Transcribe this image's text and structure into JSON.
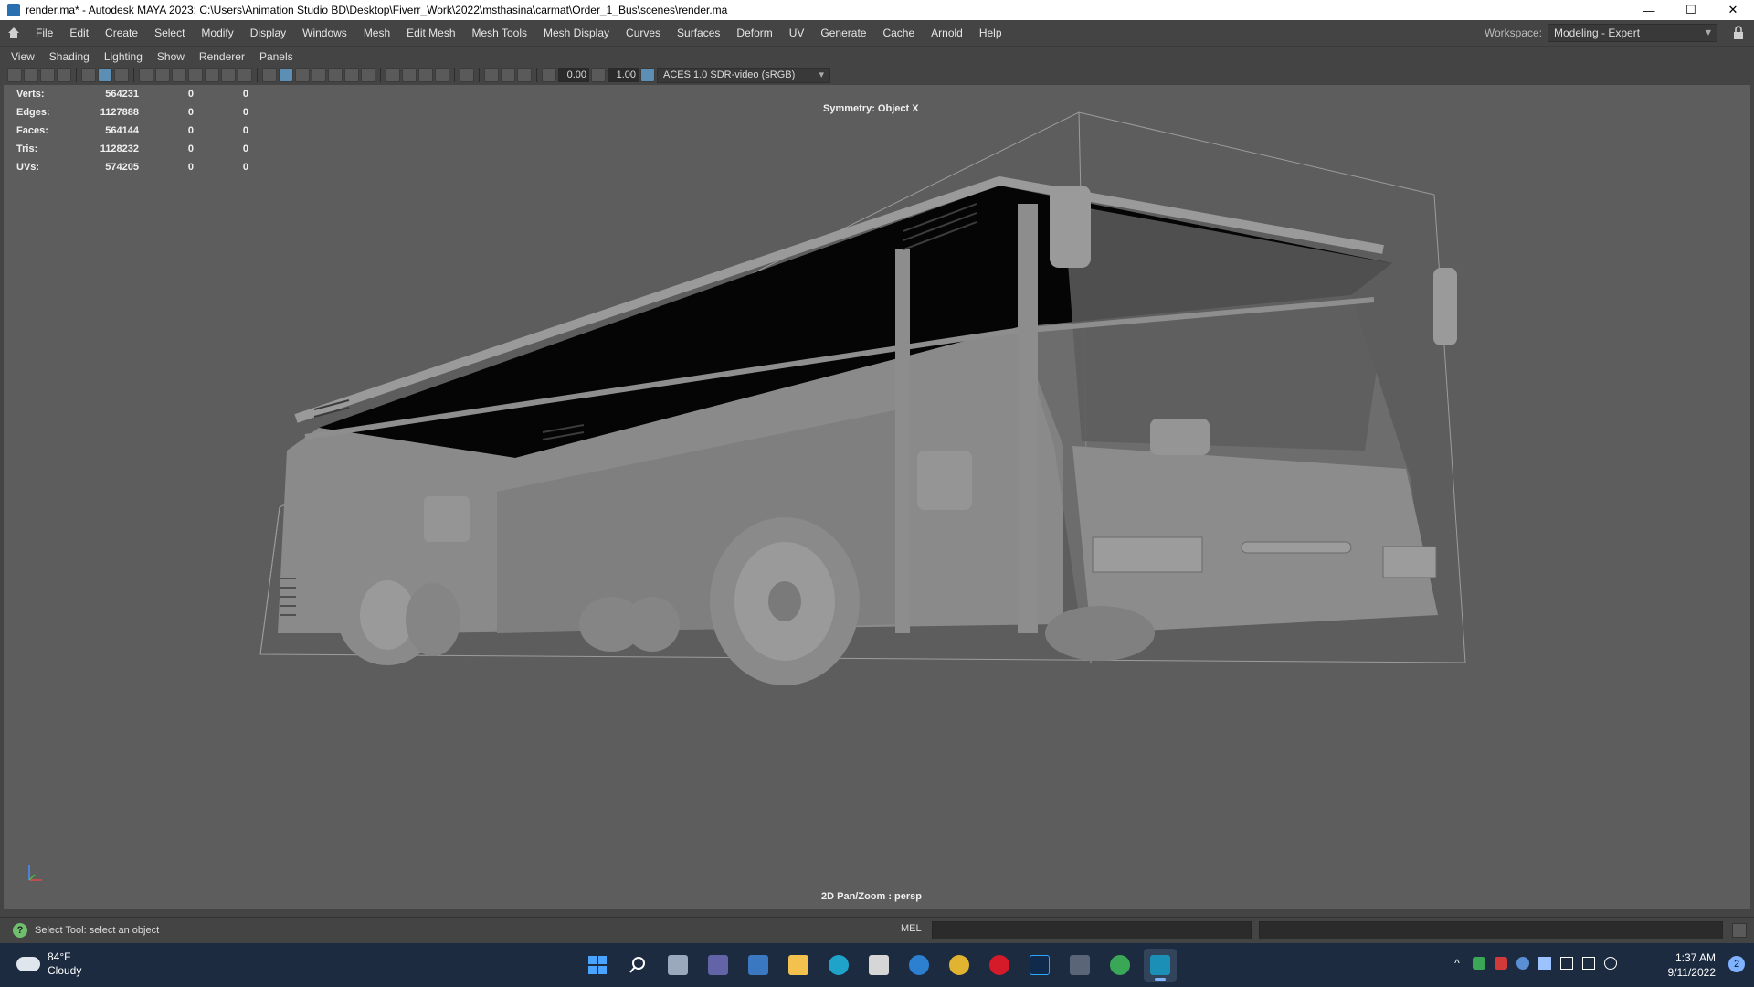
{
  "window": {
    "title": "render.ma* - Autodesk MAYA 2023: C:\\Users\\Animation Studio BD\\Desktop\\Fiverr_Work\\2022\\msthasina\\carmat\\Order_1_Bus\\scenes\\render.ma",
    "minimize_icon": "—",
    "maximize_icon": "☐",
    "close_icon": "✕"
  },
  "menubar": {
    "items": [
      "File",
      "Edit",
      "Create",
      "Select",
      "Modify",
      "Display",
      "Windows",
      "Mesh",
      "Edit Mesh",
      "Mesh Tools",
      "Mesh Display",
      "Curves",
      "Surfaces",
      "Deform",
      "UV",
      "Generate",
      "Cache",
      "Arnold",
      "Help"
    ],
    "workspace_label": "Workspace:",
    "workspace_value": "Modeling - Expert"
  },
  "panel_menu": {
    "items": [
      "View",
      "Shading",
      "Lighting",
      "Show",
      "Renderer",
      "Panels"
    ]
  },
  "toolbar": {
    "exposure": "0.00",
    "gamma": "1.00",
    "color_space": "ACES 1.0 SDR-video (sRGB)"
  },
  "viewport": {
    "stats": [
      {
        "label": "Verts:",
        "value": "564231",
        "a": "0",
        "b": "0"
      },
      {
        "label": "Edges:",
        "value": "1127888",
        "a": "0",
        "b": "0"
      },
      {
        "label": "Faces:",
        "value": "564144",
        "a": "0",
        "b": "0"
      },
      {
        "label": "Tris:",
        "value": "1128232",
        "a": "0",
        "b": "0"
      },
      {
        "label": "UVs:",
        "value": "574205",
        "a": "0",
        "b": "0"
      }
    ],
    "symmetry": "Symmetry: Object X",
    "camera_label": "2D Pan/Zoom : persp",
    "background_color": "#5d5d5d"
  },
  "helpline": {
    "text": "Select Tool: select an object",
    "mel_label": "MEL"
  },
  "taskbar": {
    "temperature": "84°F",
    "condition": "Cloudy",
    "time": "1:37 AM",
    "date": "9/11/2022",
    "notifications": "2",
    "apps": [
      "start",
      "search",
      "task-view",
      "teams",
      "photos",
      "file-explorer",
      "edge",
      "store",
      "settings",
      "chrome",
      "opera",
      "photoshop",
      "calculator",
      "chrome-profile",
      "maya"
    ]
  }
}
